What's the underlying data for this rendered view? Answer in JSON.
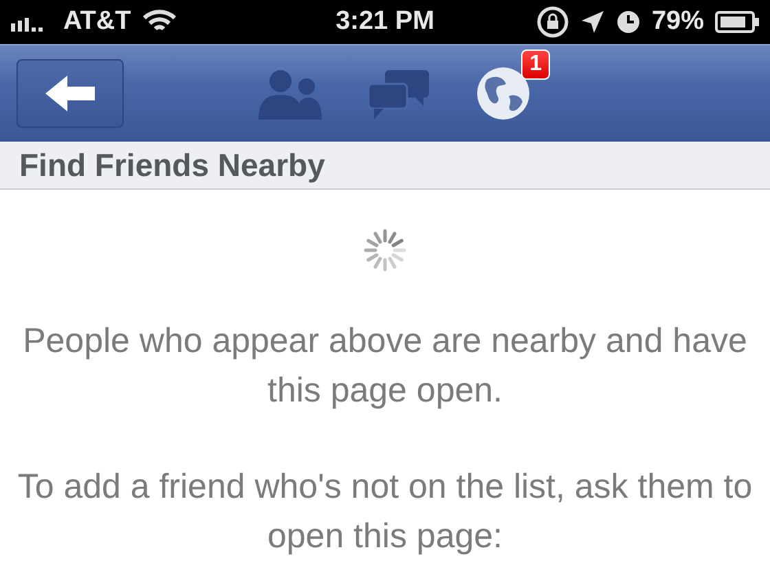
{
  "status_bar": {
    "carrier": "AT&T",
    "time": "3:21 PM",
    "battery": "79%"
  },
  "nav_bar": {
    "notification_badge": "1"
  },
  "header": {
    "title": "Find Friends Nearby"
  },
  "paragraphs": [
    "People who appear above are nearby and have this page open.",
    "To add a friend who's not on the list, ask them to open this page:"
  ]
}
